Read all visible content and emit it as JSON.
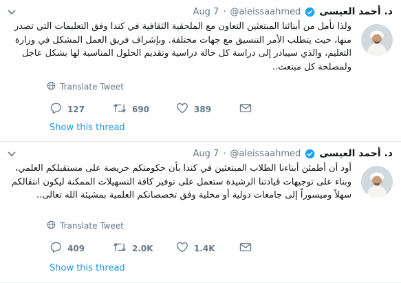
{
  "tweets": [
    {
      "name": "د. أحمد العيسى",
      "handle": "@aleissaahmed",
      "separator": "·",
      "date": "Aug 7",
      "text": "ولذا نأمل من أبنائنا المبتعثين التعاون مع الملحقية الثقافية في كندا وفق التعليمات التي تصدر منها، حيث يتطلب الأمر التنسيق مع جهات مختلفة. وبإشراف فريق العمل المشكل في وزارة التعليم، والذي سيبادر إلى دراسة كل حالة دراسية وتقديم الحلول المناسبة لها بشكل عاجل ولمصلحة كل مبتعث..",
      "translate_label": "Translate Tweet",
      "replies": "127",
      "retweets": "690",
      "likes": "389",
      "show_thread": "Show this thread"
    },
    {
      "name": "د. أحمد العيسى",
      "handle": "@aleissaahmed",
      "separator": "·",
      "date": "Aug 7",
      "text": "أود أن أطمئن  أبناءنا الطلاب المبتعثين في كندا بأن حكومتكم حريصة على مستقبلكم العلمي، وبناء على توجيهات قيادتنا الرشيدة ستعمل على توفير كافة التسهيلات الممكنة ليكون انتقالكم سهلاً وميسوراً إلى جامعات دولية أو محلية وفق تخصصاتكم العلمية بمشيئة الله تعالى..",
      "translate_label": "Translate Tweet",
      "replies": "409",
      "retweets": "2.0K",
      "likes": "1.4K",
      "show_thread": "Show this thread"
    }
  ],
  "colors": {
    "background": "#e6ecf0",
    "text": "#14171a",
    "secondary": "#657786",
    "link": "#1b95e0",
    "verified": "#1da1f2"
  },
  "icons": [
    "caret-down-icon",
    "verified-badge-icon",
    "globe-icon",
    "reply-icon",
    "retweet-icon",
    "like-icon",
    "direct-message-icon"
  ]
}
